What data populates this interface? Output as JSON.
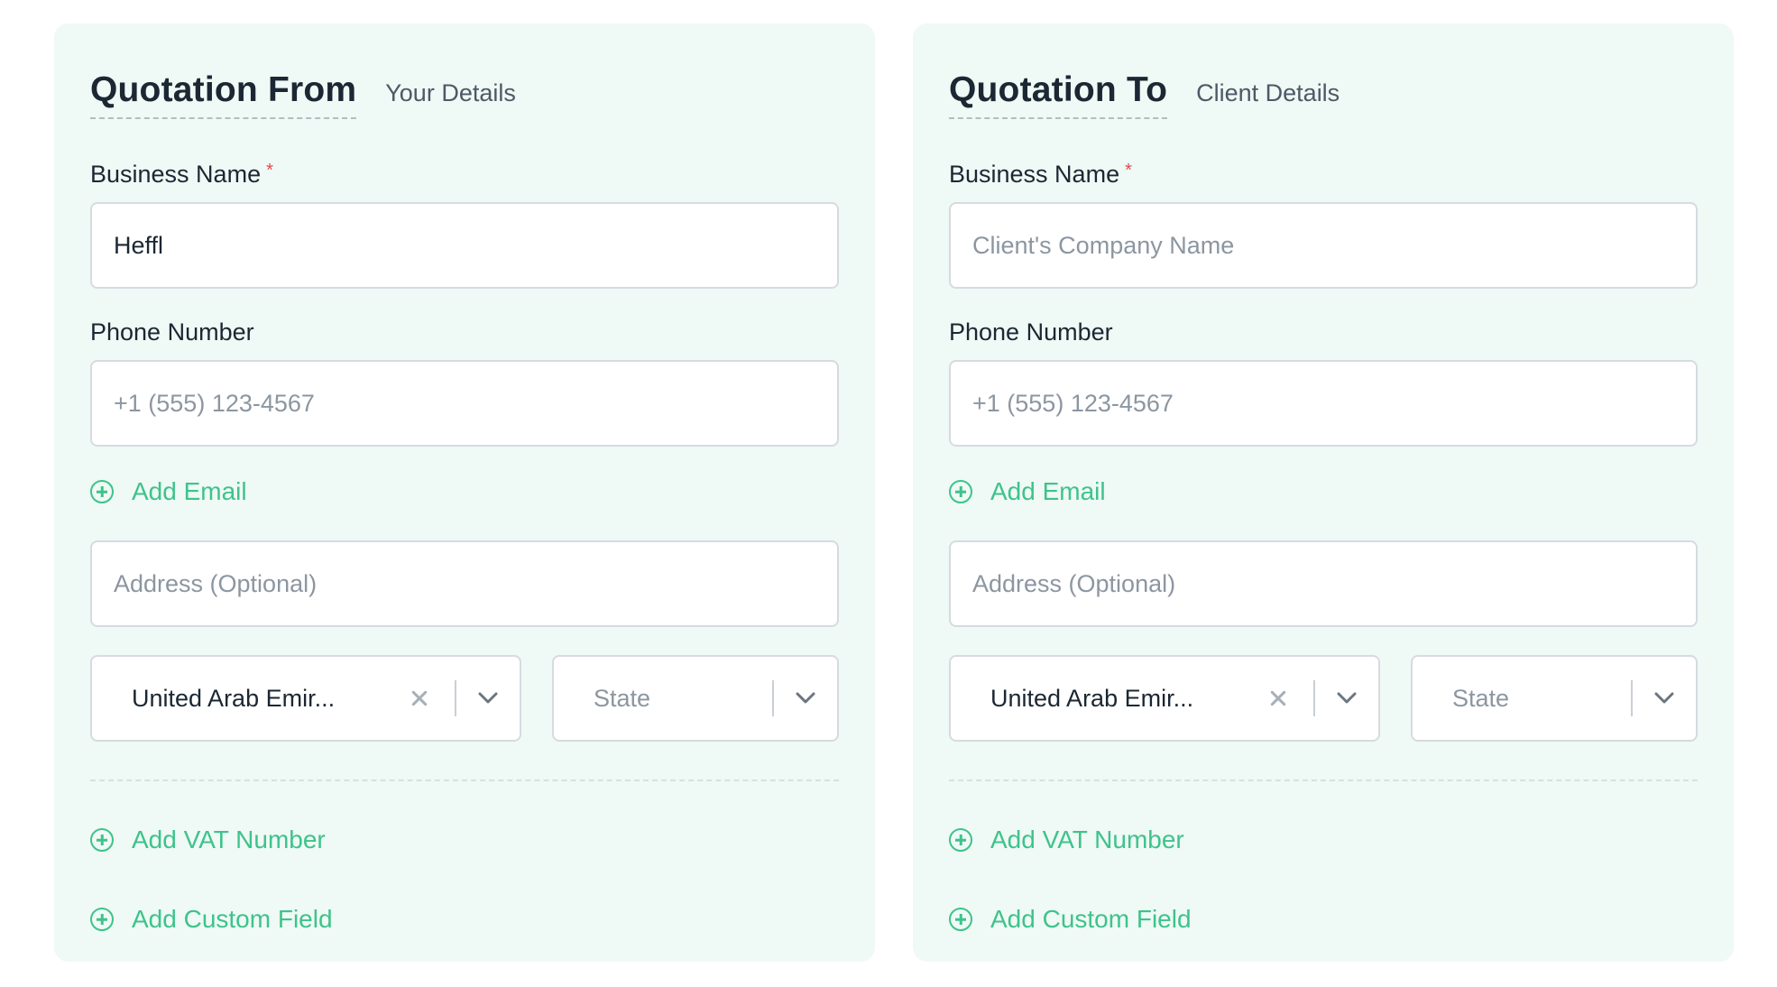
{
  "from": {
    "title": "Quotation From",
    "subtitle": "Your Details",
    "business_name_label": "Business Name",
    "required_mark": "*",
    "business_name_value": "Heffl",
    "business_name_placeholder": "",
    "phone_label": "Phone Number",
    "phone_placeholder": "+1 (555) 123-4567",
    "add_email": "Add Email",
    "address_placeholder": "Address (Optional)",
    "country_value": "United Arab Emir...",
    "state_placeholder": "State",
    "add_vat": "Add VAT Number",
    "add_custom": "Add Custom Field"
  },
  "to": {
    "title": "Quotation To",
    "subtitle": "Client Details",
    "business_name_label": "Business Name",
    "required_mark": "*",
    "business_name_value": "",
    "business_name_placeholder": "Client's Company Name",
    "phone_label": "Phone Number",
    "phone_placeholder": "+1 (555) 123-4567",
    "add_email": "Add Email",
    "address_placeholder": "Address (Optional)",
    "country_value": "United Arab Emir...",
    "state_placeholder": "State",
    "add_vat": "Add VAT Number",
    "add_custom": "Add Custom Field"
  },
  "colors": {
    "card_bg": "#eff9f5",
    "accent": "#3ec38b",
    "required": "#e5484d",
    "text": "#1b2733"
  },
  "icons": {
    "add": "plus-circle-icon",
    "clear": "close-icon",
    "dropdown": "chevron-down-icon"
  }
}
